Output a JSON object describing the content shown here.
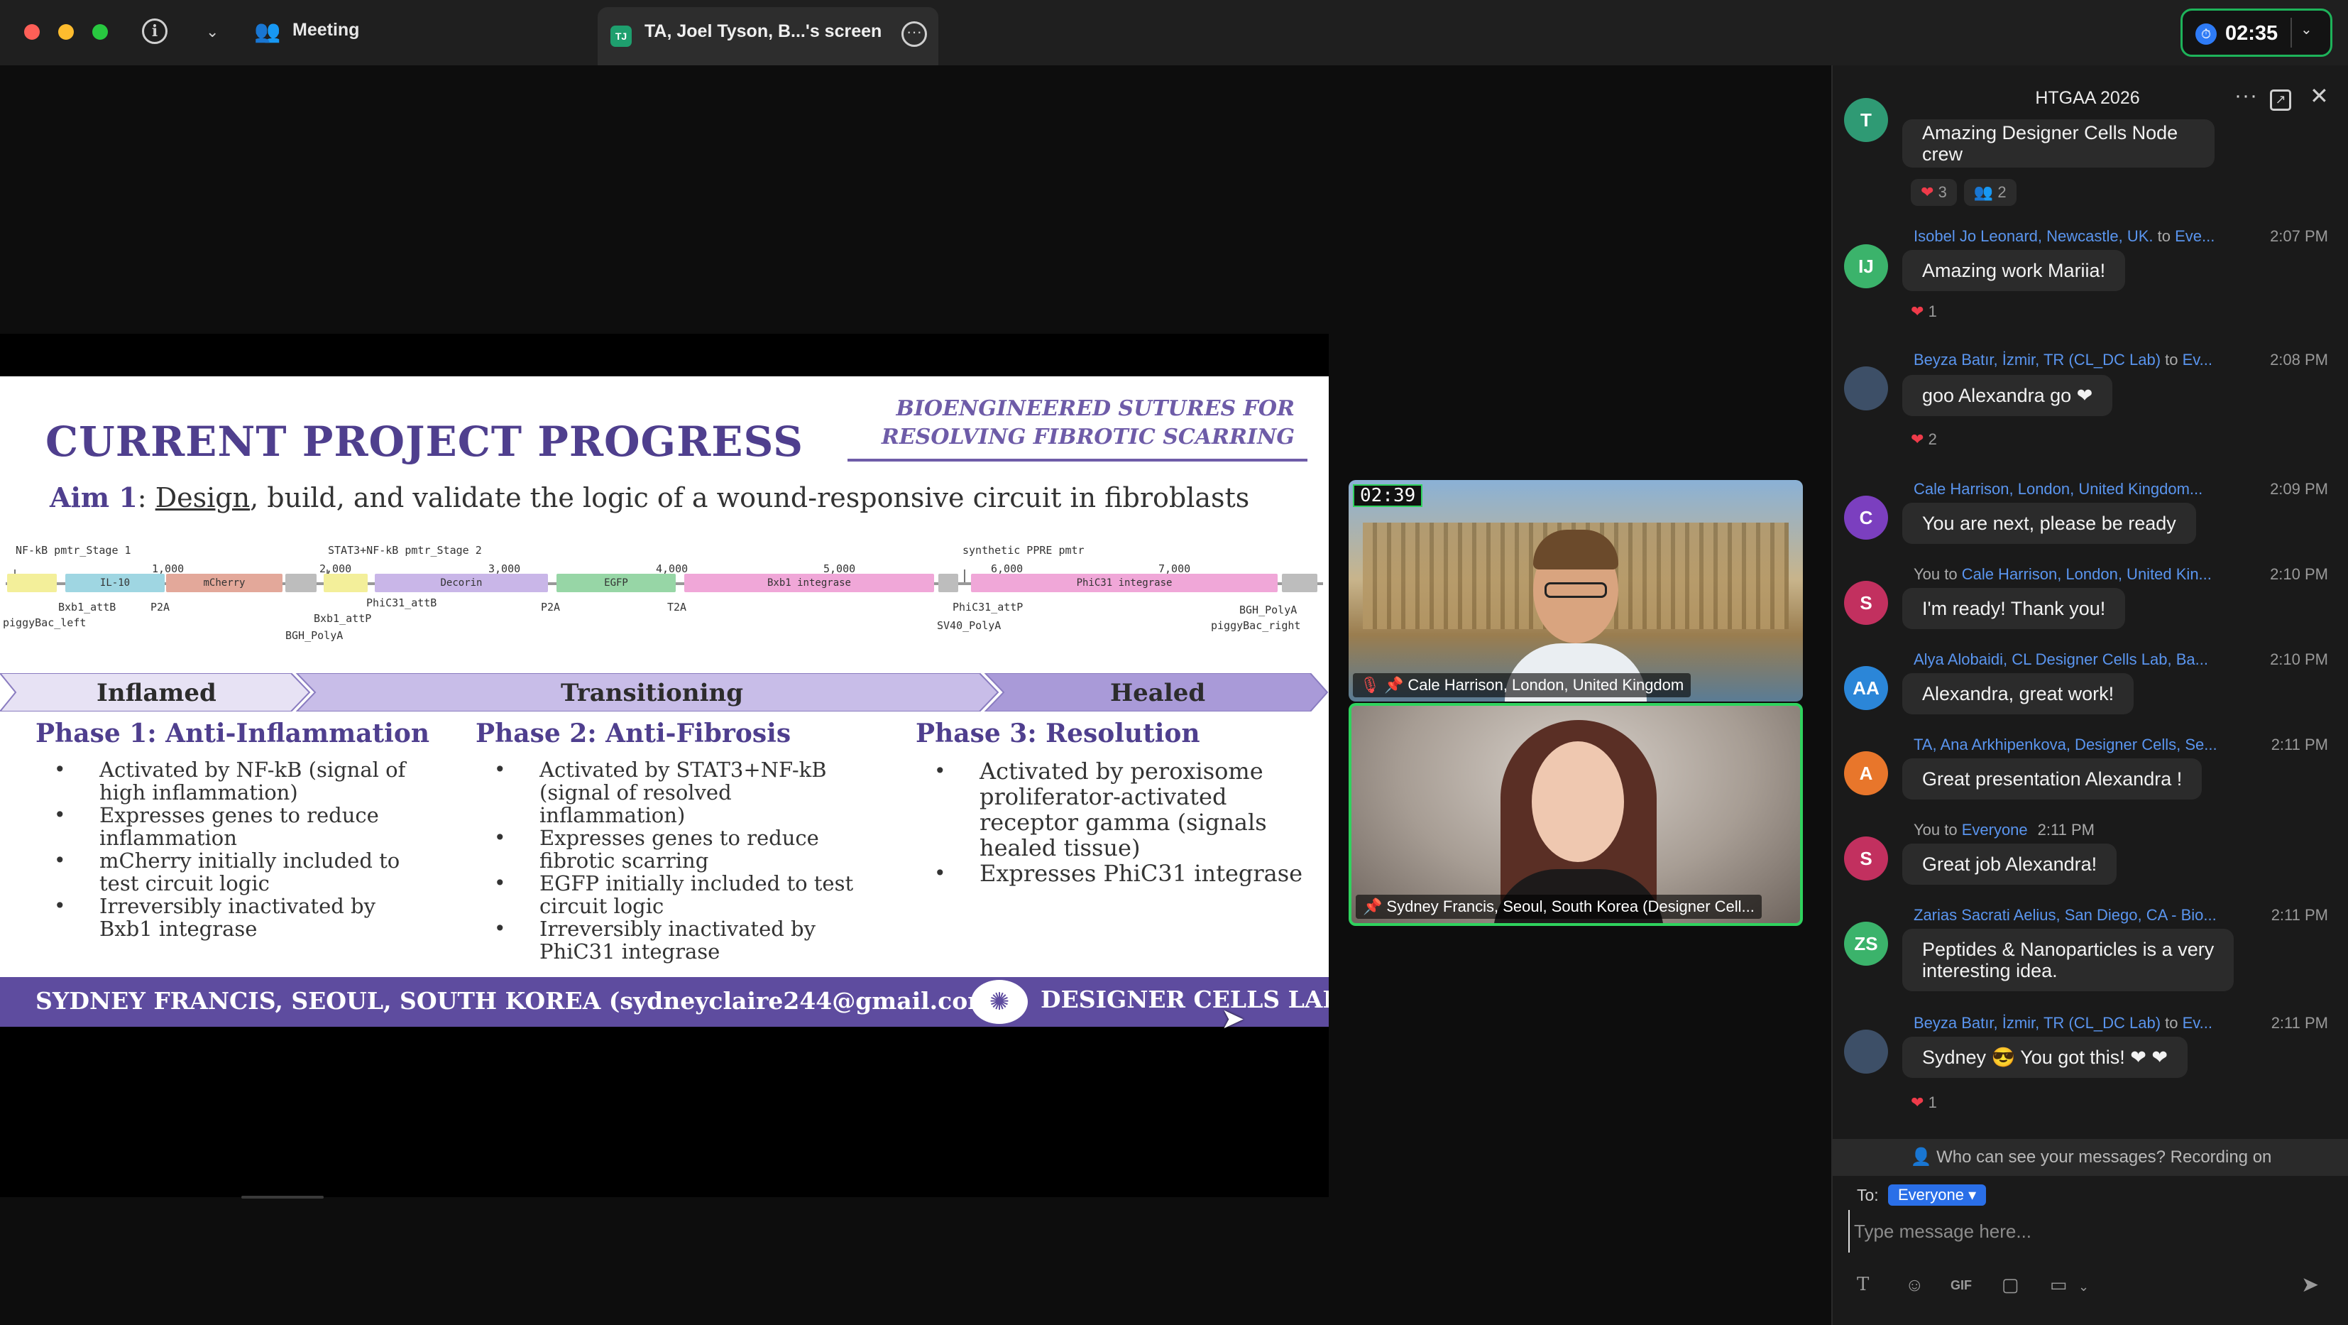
{
  "titlebar": {
    "meeting_label": "Meeting",
    "share_badge": "TJ",
    "share_label": "TA, Joel Tyson, B...'s screen",
    "timer": "02:35"
  },
  "slide": {
    "title": "CURRENT PROJECT PROGRESS",
    "subtitle_line1": "BIOENGINEERED SUTURES FOR",
    "subtitle_line2": "RESOLVING FIBROTIC SCARRING",
    "aim_label": "Aim 1",
    "aim_sep": ": ",
    "aim_design": "Design",
    "aim_rest": ", build, and validate the logic of a wound-responsive circuit in fibroblasts",
    "map": {
      "promoter1": "NF-kB pmtr_Stage 1",
      "promoter2": "STAT3+NF-kB pmtr_Stage 2",
      "promoter3": "synthetic PPRE pmtr",
      "ticks": [
        "1,000",
        "2,000",
        "3,000",
        "4,000",
        "5,000",
        "6,000",
        "7,000"
      ],
      "feature_il10": "IL-10",
      "feature_mcherry": "mCherry",
      "feature_decorin": "Decorin",
      "feature_egfp": "EGFP",
      "feature_bxb1": "Bxb1 integrase",
      "feature_phic31": "PhiC31 integrase",
      "lbl_bxb1_attb": "Bxb1_attB",
      "lbl_piggybac_left": "piggyBac_left",
      "lbl_p2a_1": "P2A",
      "lbl_bgh_polya_1": "BGH_PolyA",
      "lbl_bxb1_attp": "Bxb1_attP",
      "lbl_phic31_attb": "PhiC31_attB",
      "lbl_p2a_2": "P2A",
      "lbl_t2a": "T2A",
      "lbl_phic31_attp": "PhiC31_attP",
      "lbl_sv40_polya": "SV40_PolyA",
      "lbl_bgh_polya_2": "BGH_PolyA",
      "lbl_piggybac_right": "piggyBac_right"
    },
    "bands": [
      "Inflamed",
      "Transitioning",
      "Healed"
    ],
    "phases": [
      {
        "title": "Phase 1: Anti-Inflammation",
        "items": [
          "Activated by NF-kB (signal of high inflammation)",
          "Expresses genes to reduce inflammation",
          "mCherry initially included to test circuit logic",
          "Irreversibly inactivated by Bxb1 integrase"
        ]
      },
      {
        "title": "Phase 2: Anti-Fibrosis",
        "items": [
          "Activated by STAT3+NF-kB (signal of resolved inflammation)",
          "Expresses genes to reduce fibrotic scarring",
          "EGFP initially included to test circuit logic",
          "Irreversibly inactivated by PhiC31 integrase"
        ]
      },
      {
        "title": "Phase 3: Resolution",
        "items": [
          "Activated by peroxisome proliferator-activated receptor gamma (signals healed tissue)",
          "Expresses PhiC31 integrase"
        ]
      }
    ],
    "footer_left": "SYDNEY FRANCIS, SEOUL, SOUTH KOREA (sydneyclaire244@gmail.com)",
    "footer_right": "DESIGNER CELLS LAB"
  },
  "videos": [
    {
      "name": "Cale Harrison, London, United Kingdom",
      "timer": "02:39",
      "muted": true
    },
    {
      "name": "Sydney Francis, Seoul, South Korea (Designer Cell...",
      "muted": false
    }
  ],
  "chat": {
    "title": "HTGAA 2026",
    "messages": [
      {
        "avatar": "T",
        "avatar_color": "#2f9a74",
        "text": "Amazing Designer Cells Node crew",
        "reactions": [
          "3",
          "2"
        ]
      },
      {
        "avatar": "IJ",
        "avatar_color": "#3bb36b",
        "sender": "Isobel Jo Leonard, Newcastle, UK.",
        "to": " to ",
        "target": "Eve...",
        "time": "2:07 PM",
        "text": "Amazing work Mariia!",
        "reaction": "1"
      },
      {
        "avatar": "",
        "sender": "Beyza Batır, İzmir, TR (CL_DC Lab)",
        "to": " to ",
        "target": "Ev...",
        "time": "2:08 PM",
        "text": "goo Alexandra go ❤",
        "reaction": "2"
      },
      {
        "avatar": "C",
        "avatar_color": "#7b3fbf",
        "sender": "Cale Harrison, London, United Kingdom...",
        "time": "2:09 PM",
        "text": "You are next, please be ready"
      },
      {
        "avatar": "S",
        "avatar_color": "#c2305f",
        "sender": "You",
        "to": " to ",
        "target": "Cale Harrison, London, United Kin...",
        "time": "2:10 PM",
        "text": "I'm ready! Thank you!"
      },
      {
        "avatar": "AA",
        "avatar_color": "#2b86d8",
        "sender": "Alya Alobaidi, CL Designer Cells Lab, Ba...",
        "time": "2:10 PM",
        "text": "Alexandra, great work!"
      },
      {
        "avatar": "A",
        "avatar_color": "#e8762b",
        "sender": "TA, Ana Arkhipenkova, Designer Cells, Se...",
        "time": "2:11 PM",
        "text": "Great presentation Alexandra !"
      },
      {
        "avatar": "S",
        "avatar_color": "#c2305f",
        "sender": "You",
        "to": " to ",
        "target": "Everyone",
        "time": "2:11 PM",
        "text": "Great job Alexandra!"
      },
      {
        "avatar": "ZS",
        "avatar_color": "#3bb36b",
        "sender": "Zarias Sacrati Aelius, San Diego, CA - Bio...",
        "time": "2:11 PM",
        "text_line1": "Peptides & Nanoparticles is a very",
        "text_line2": "interesting idea."
      },
      {
        "avatar": "",
        "sender": "Beyza Batır, İzmir, TR (CL_DC Lab)",
        "to": " to ",
        "target": "Ev...",
        "time": "2:11 PM",
        "text": "Sydney 😎 You got this!  ❤ ❤",
        "reaction": "1"
      }
    ],
    "notice": "Who can see your messages? Recording on",
    "to_label": "To:",
    "to_value": "Everyone",
    "input_placeholder": "Type message here...",
    "tools": [
      "T",
      "☺",
      "GIF",
      "▢",
      "▭"
    ]
  }
}
